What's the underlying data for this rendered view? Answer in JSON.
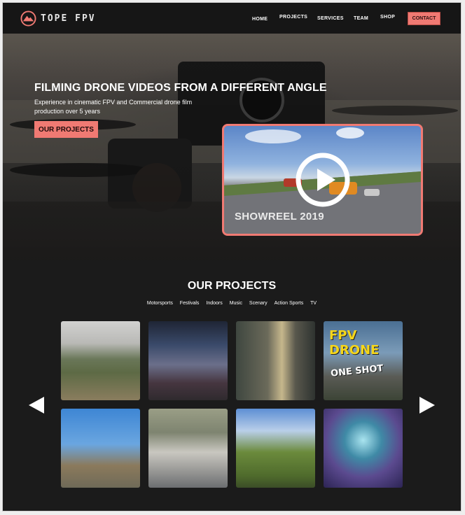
{
  "brand": {
    "name": "TOPE FPV",
    "logo_icon": "mountain-logo-icon",
    "accent": "#f07a73"
  },
  "nav": {
    "items": [
      {
        "label": "HOME"
      },
      {
        "label": "PROJECTS"
      },
      {
        "label": "SERVICES"
      },
      {
        "label": "TEAM"
      },
      {
        "label": "SHOP"
      }
    ],
    "contact_label": "CONTACT"
  },
  "hero": {
    "title": "FILMING DRONE VIDEOS FROM A DIFFERENT ANGLE",
    "subtitle": "Experience in cinematic FPV and Commercial drone film production over 5 years",
    "cta_label": "OUR PROJECTS",
    "showreel": {
      "label": "SHOWREEL 2019",
      "icon": "play-icon"
    }
  },
  "projects": {
    "title": "OUR PROJECTS",
    "filters": [
      "Motorsports",
      "Festivals",
      "Indoors",
      "Music",
      "Scenary",
      "Action Sports",
      "TV"
    ],
    "tiles": [
      {
        "icon": "mountain-landscape-thumbnail"
      },
      {
        "icon": "concert-stage-thumbnail"
      },
      {
        "icon": "forest-house-thumbnail"
      },
      {
        "icon": "fpv-drone-one-shot-thumbnail",
        "line1": "FPV",
        "line2": "DRONE",
        "line3": "ONE SHOT"
      },
      {
        "icon": "motocross-jump-thumbnail"
      },
      {
        "icon": "drift-cars-thumbnail"
      },
      {
        "icon": "valley-road-thumbnail"
      },
      {
        "icon": "dancers-underwater-thumbnail"
      }
    ],
    "prev_icon": "arrow-left-icon",
    "next_icon": "arrow-right-icon"
  }
}
